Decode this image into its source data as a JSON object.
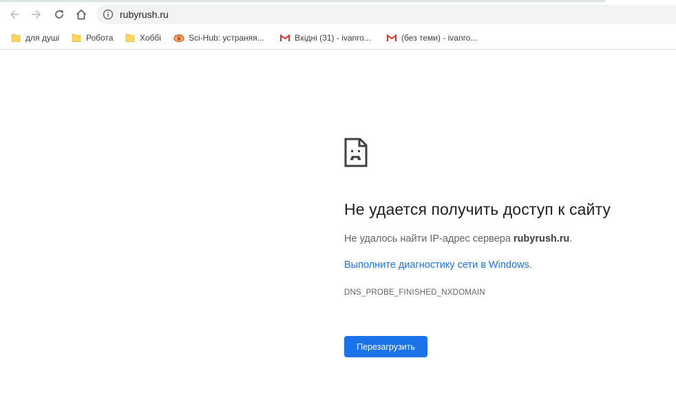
{
  "browser": {
    "url": "rubyrush.ru",
    "nav": {
      "back_icon": "back-arrow-icon",
      "forward_icon": "forward-arrow-icon",
      "reload_icon": "reload-icon",
      "home_icon": "home-icon",
      "site_info_icon": "info-icon"
    }
  },
  "bookmarks": [
    {
      "label": "для душі",
      "icon": "folder-icon"
    },
    {
      "label": "Робота",
      "icon": "folder-icon"
    },
    {
      "label": "Хоббі",
      "icon": "folder-icon"
    },
    {
      "label": "Sci-Hub: устраняя...",
      "icon": "scihub-icon"
    },
    {
      "label": "Вхідні (31) - ivanro...",
      "icon": "gmail-icon"
    },
    {
      "label": "(без теми) - ivanro...",
      "icon": "gmail-icon"
    }
  ],
  "error": {
    "icon": "sad-page-icon",
    "title": "Не удается получить доступ к сайту",
    "desc_prefix": "Не удалось найти IP-адрес сервера ",
    "desc_host": "rubyrush.ru",
    "desc_suffix": ".",
    "link_text": "Выполните диагностику сети в Windows",
    "link_suffix": ".",
    "code": "DNS_PROBE_FINISHED_NXDOMAIN",
    "reload_label": "Перезагрузить"
  },
  "colors": {
    "accent": "#1a73e8",
    "folder": "#fbd85c",
    "gmail": "#d93025"
  }
}
